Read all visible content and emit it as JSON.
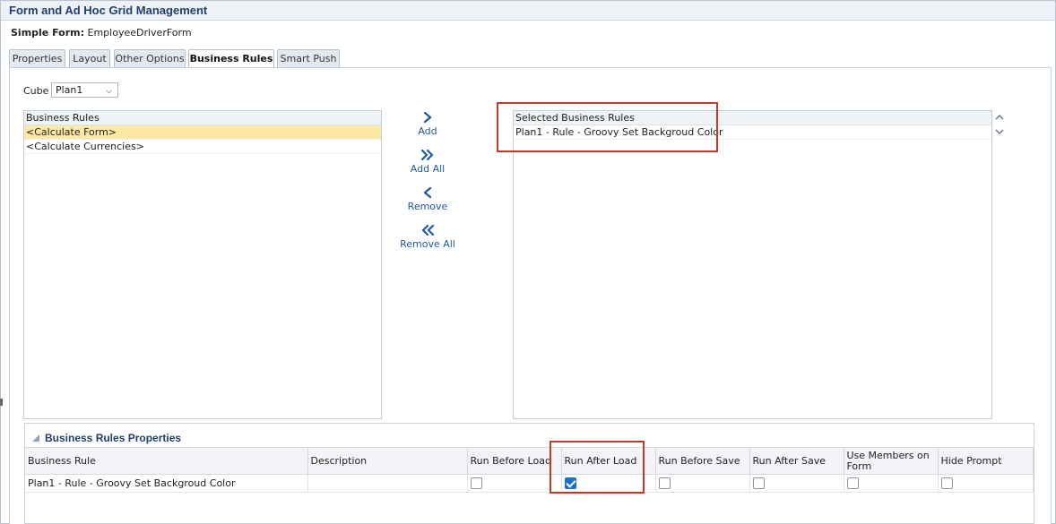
{
  "window": {
    "title": "Form and Ad Hoc Grid Management"
  },
  "form": {
    "type_label": "Simple Form:",
    "name": "EmployeeDriverForm"
  },
  "tabs": [
    {
      "label": "Properties",
      "active": false
    },
    {
      "label": "Layout",
      "active": false
    },
    {
      "label": "Other Options",
      "active": false
    },
    {
      "label": "Business Rules",
      "active": true
    },
    {
      "label": "Smart Push",
      "active": false
    }
  ],
  "cube": {
    "label": "Cube",
    "value": "Plan1"
  },
  "available_rules": {
    "header": "Business Rules",
    "items": [
      "<Calculate Form>",
      "<Calculate Currencies>"
    ],
    "selected_index": 0
  },
  "move_buttons": {
    "add": "Add",
    "add_all": "Add All",
    "remove": "Remove",
    "remove_all": "Remove All"
  },
  "selected_rules": {
    "header": "Selected Business Rules",
    "items": [
      "Plan1 - Rule - Groovy Set Backgroud Color"
    ]
  },
  "properties": {
    "title": "Business Rules Properties",
    "columns": [
      "Business Rule",
      "Description",
      "Run Before Load",
      "Run After Load",
      "Run Before Save",
      "Run After Save",
      "Use Members on Form",
      "Hide Prompt"
    ],
    "rows": [
      {
        "rule": "Plan1 - Rule - Groovy Set Backgroud Color",
        "description": "",
        "run_before_load": false,
        "run_after_load": true,
        "run_before_save": false,
        "run_after_save": false,
        "use_members_on_form": false,
        "hide_prompt": false
      }
    ]
  },
  "colors": {
    "accent": "#1f5aa0",
    "highlight": "#fde9a7",
    "annotation": "#c0392b",
    "checkbox_checked": "#1a6fc9"
  }
}
